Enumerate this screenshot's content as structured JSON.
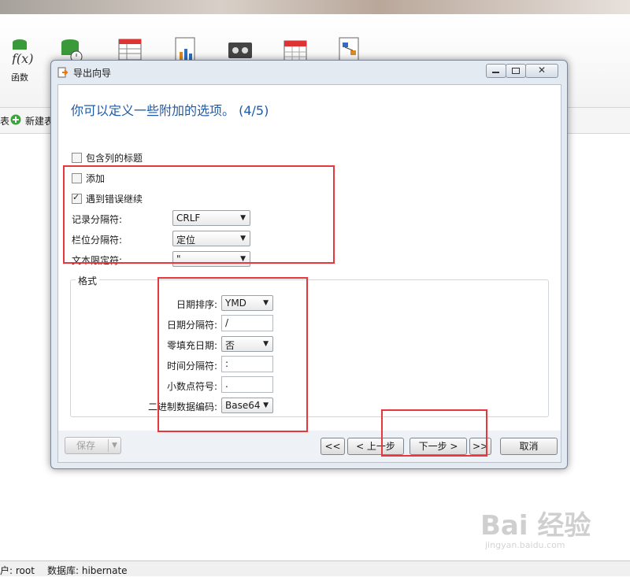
{
  "app": {
    "ribbon": [
      {
        "label": "函数",
        "icon": "function-icon"
      },
      {
        "label": "",
        "icon": "database-clock-icon"
      },
      {
        "label": "",
        "icon": "table-grid-icon"
      },
      {
        "label": "",
        "icon": "report-chart-icon"
      },
      {
        "label": "",
        "icon": "backup-tape-icon"
      },
      {
        "label": "",
        "icon": "calendar-icon"
      },
      {
        "label": "",
        "icon": "model-diagram-icon"
      }
    ],
    "toolbar": {
      "left_fragment": "表",
      "new_table": "新建表"
    },
    "statusbar": {
      "user": "户: root",
      "database": "数据库: hibernate"
    }
  },
  "dialog": {
    "title": "导出向导",
    "heading": "你可以定义一些附加的选项。 (4/5)",
    "options": {
      "include_headers": {
        "label": "包含列的标题",
        "checked": false
      },
      "append": {
        "label": "添加",
        "checked": false
      },
      "continue_on_error": {
        "label": "遇到错误继续",
        "checked": true
      }
    },
    "record_delimiter": {
      "label": "记录分隔符:",
      "value": "CRLF"
    },
    "field_delimiter": {
      "label": "栏位分隔符:",
      "value": "定位"
    },
    "text_qualifier": {
      "label": "文本限定符:",
      "value": "\""
    },
    "format": {
      "caption": "格式",
      "date_order": {
        "label": "日期排序:",
        "value": "YMD"
      },
      "date_delimiter": {
        "label": "日期分隔符:",
        "value": "/"
      },
      "zero_padding_date": {
        "label": "零填充日期:",
        "value": "否"
      },
      "time_delimiter": {
        "label": "时间分隔符:",
        "value": ":"
      },
      "decimal_symbol": {
        "label": "小数点符号:",
        "value": "."
      },
      "binary_encoding": {
        "label": "二进制数据编码:",
        "value": "Base64"
      }
    },
    "buttons": {
      "save": "保存",
      "first": "<<",
      "prev": "< 上一步",
      "next": "下一步 >",
      "last": ">>",
      "cancel": "取消"
    }
  },
  "watermark": {
    "brand": "Bai 经验",
    "url": "jingyan.baidu.com"
  },
  "colors": {
    "heading": "#1e5aa8",
    "highlight": "#e8363c"
  }
}
